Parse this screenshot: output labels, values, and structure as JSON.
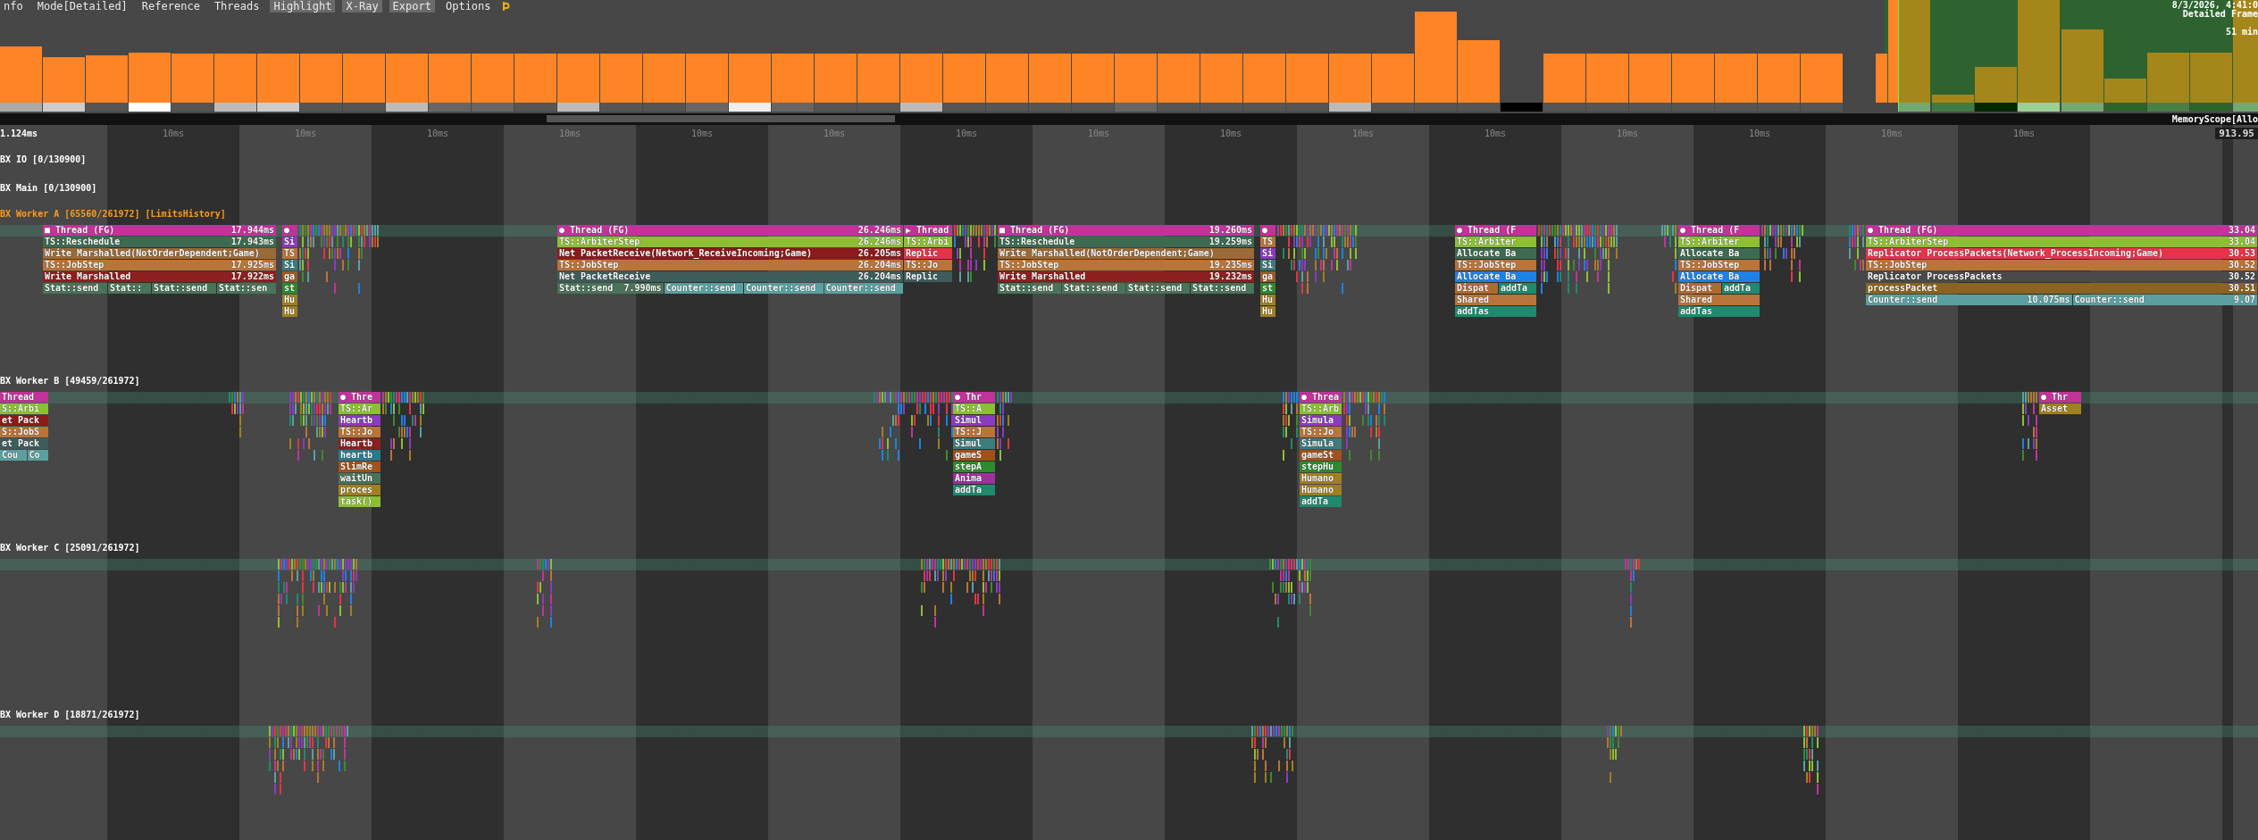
{
  "menu": [
    {
      "label": "nfo",
      "on": false
    },
    {
      "label": "Mode[Detailed]",
      "on": false
    },
    {
      "label": "Reference",
      "on": false
    },
    {
      "label": "Threads",
      "on": false
    },
    {
      "label": "Highlight",
      "on": true
    },
    {
      "label": "X-Ray",
      "on": true
    },
    {
      "label": "Export",
      "on": true
    },
    {
      "label": "Options",
      "on": false
    }
  ],
  "capture_info": {
    "date": "8/3/2026, 4:41:0",
    "mode": "Detailed Frame",
    "duration": "51 min"
  },
  "scrollbar": {
    "label": "MemoryScope[Allo"
  },
  "ruler": {
    "start": "1.124ms",
    "ticks": [
      "10ms",
      "10ms",
      "10ms",
      "10ms",
      "10ms",
      "10ms",
      "10ms",
      "10ms",
      "10ms",
      "10ms",
      "10ms",
      "10ms",
      "10ms",
      "10ms",
      "10ms"
    ],
    "end": "913.95"
  },
  "threads": [
    {
      "name": "BX IO [0/130900]",
      "selected": false
    },
    {
      "name": "BX Main [0/130900]",
      "selected": false
    },
    {
      "name": "BX Worker A [65560/261972] [LimitsHistory]",
      "selected": true,
      "stacks": [
        {
          "rows": [
            [
              {
                "label": "■ Thread (FG)",
                "time": "17.944ms",
                "color": "#c2339a"
              }
            ],
            [
              {
                "label": "TS::Reschedule",
                "time": "17.943ms",
                "color": "#3d6b52"
              }
            ],
            [
              {
                "label": "Write Marshalled(NotOrderDependent;Game)",
                "color": "#9a6a38"
              }
            ],
            [
              {
                "label": "TS::JobStep",
                "time": "17.925ms",
                "color": "#b8743a"
              }
            ],
            [
              {
                "label": "Write Marshalled",
                "time": "17.922ms",
                "color": "#8c2020"
              }
            ],
            [
              {
                "label": "Stat::send",
                "color": "#4b7358"
              },
              {
                "label": "Stat::",
                "color": "#4b7358"
              },
              {
                "label": "Stat::send",
                "color": "#4b7358"
              },
              {
                "label": "Stat::sen",
                "color": "#4b7358"
              }
            ]
          ]
        },
        {
          "rows": [
            [
              {
                "label": "●",
                "color": "#c2339a"
              }
            ],
            [
              {
                "label": "Si",
                "color": "#8b3bbf"
              }
            ],
            [
              {
                "label": "TS",
                "color": "#b8743a"
              }
            ],
            [
              {
                "label": "Si",
                "color": "#3e7c7c"
              }
            ],
            [
              {
                "label": "ga",
                "color": "#9c5a2a"
              }
            ],
            [
              {
                "label": "st",
                "color": "#2e8a2e"
              }
            ],
            [
              {
                "label": "Hu",
                "color": "#a08020"
              }
            ],
            [
              {
                "label": "Hu",
                "color": "#a08020"
              }
            ]
          ]
        },
        {
          "rows": [
            [
              {
                "label": "● Thread (FG)",
                "time": "26.246ms",
                "color": "#c2339a"
              }
            ],
            [
              {
                "label": "TS::ArbiterStep",
                "time": "26.246ms",
                "color": "#8dbf34"
              }
            ],
            [
              {
                "label": "Net PacketReceive(Network_ReceiveIncoming;Game)",
                "time": "26.205ms",
                "color": "#8c1b1b"
              }
            ],
            [
              {
                "label": "TS::JobStep",
                "time": "26.204ms",
                "color": "#b8743a"
              }
            ],
            [
              {
                "label": "Net PacketReceive",
                "time": "26.204ms",
                "color": "#3e5c5a"
              }
            ],
            [
              {
                "label": "Stat::send",
                "time": "7.990ms",
                "color": "#4b7358"
              },
              {
                "label": "Counter::send",
                "color": "#5aa0a0"
              },
              {
                "label": "Counter::send",
                "color": "#5aa0a0"
              },
              {
                "label": "Counter::send",
                "color": "#5aa0a0"
              }
            ]
          ]
        },
        {
          "rows": [
            [
              {
                "label": "▶ Thread",
                "color": "#c2339a"
              }
            ],
            [
              {
                "label": "TS::Arbi",
                "color": "#8dbf34"
              }
            ],
            [
              {
                "label": "Replic",
                "color": "#e33448"
              }
            ],
            [
              {
                "label": "TS::Jo",
                "color": "#b8743a"
              }
            ],
            [
              {
                "label": "Replic",
                "color": "#3e5c5a"
              }
            ]
          ]
        },
        {
          "rows": [
            [
              {
                "label": "■ Thread (FG)",
                "time": "19.260ms",
                "color": "#c2339a"
              }
            ],
            [
              {
                "label": "TS::Reschedule",
                "time": "19.259ms",
                "color": "#3d6b52"
              }
            ],
            [
              {
                "label": "Write Marshalled(NotOrderDependent;Game)",
                "color": "#9a6a38"
              }
            ],
            [
              {
                "label": "TS::JobStep",
                "time": "19.235ms",
                "color": "#b8743a"
              }
            ],
            [
              {
                "label": "Write Marshalled",
                "time": "19.232ms",
                "color": "#8c2020"
              }
            ],
            [
              {
                "label": "Stat::send",
                "color": "#4b7358"
              },
              {
                "label": "Stat::send",
                "color": "#4b7358"
              },
              {
                "label": "Stat::send",
                "color": "#4b7358"
              },
              {
                "label": "Stat::send",
                "color": "#4b7358"
              }
            ]
          ]
        },
        {
          "rows": [
            [
              {
                "label": "●",
                "color": "#c2339a"
              }
            ],
            [
              {
                "label": "TS",
                "color": "#b8743a"
              }
            ],
            [
              {
                "label": "Si",
                "color": "#8b3bbf"
              }
            ],
            [
              {
                "label": "Si",
                "color": "#3e7c7c"
              }
            ],
            [
              {
                "label": "ga",
                "color": "#9c5a2a"
              }
            ],
            [
              {
                "label": "st",
                "color": "#2e8a2e"
              }
            ],
            [
              {
                "label": "Hu",
                "color": "#a08020"
              }
            ],
            [
              {
                "label": "Hu",
                "color": "#a08020"
              }
            ]
          ]
        },
        {
          "rows": [
            [
              {
                "label": "● Thread (F",
                "color": "#c2339a"
              }
            ],
            [
              {
                "label": "TS::Arbiter",
                "color": "#8dbf34"
              }
            ],
            [
              {
                "label": "Allocate Ba",
                "color": "#3d6b52"
              }
            ],
            [
              {
                "label": "TS::JobStep",
                "color": "#b8743a"
              }
            ],
            [
              {
                "label": "Allocate Ba",
                "color": "#1f80e6"
              }
            ],
            [
              {
                "label": "Dispat",
                "color": "#b06a30"
              },
              {
                "label": "addTa",
                "color": "#1f8a6e"
              }
            ],
            [
              {
                "label": "Shared",
                "color": "#b8743a"
              }
            ],
            [
              {
                "label": "addTas",
                "color": "#1f8a6e"
              }
            ]
          ]
        },
        {
          "rows": [
            [
              {
                "label": "● Thread (F",
                "color": "#c2339a"
              }
            ],
            [
              {
                "label": "TS::Arbiter",
                "color": "#8dbf34"
              }
            ],
            [
              {
                "label": "Allocate Ba",
                "color": "#3d6b52"
              }
            ],
            [
              {
                "label": "TS::JobStep",
                "color": "#b8743a"
              }
            ],
            [
              {
                "label": "Allocate Ba",
                "color": "#1f80e6"
              }
            ],
            [
              {
                "label": "Dispat",
                "color": "#b06a30"
              },
              {
                "label": "addTa",
                "color": "#1f8a6e"
              }
            ],
            [
              {
                "label": "Shared",
                "color": "#b8743a"
              }
            ],
            [
              {
                "label": "addTas",
                "color": "#1f8a6e"
              }
            ]
          ]
        },
        {
          "rows": [
            [
              {
                "label": "● Thread (FG)",
                "time": "33.04",
                "color": "#c2339a"
              }
            ],
            [
              {
                "label": "TS::ArbiterStep",
                "time": "33.04",
                "color": "#8dbf34"
              }
            ],
            [
              {
                "label": "Replicator ProcessPackets(Network_ProcessIncoming;Game)",
                "time": "30.53",
                "color": "#e8334a"
              }
            ],
            [
              {
                "label": "TS::JobStep",
                "time": "30.52",
                "color": "#b8743a"
              }
            ],
            [
              {
                "label": "Replicator ProcessPackets",
                "time": "30.52",
                "color": "#4a4a4a"
              }
            ],
            [
              {
                "label": "processPacket",
                "time": "30.51",
                "color": "#8a6420"
              }
            ],
            [
              {
                "label": "Counter::send",
                "time": "10.075ms",
                "color": "#5aa0a0"
              },
              {
                "label": "Counter::send",
                "time": "9.07",
                "color": "#5aa0a0"
              }
            ]
          ]
        }
      ]
    },
    {
      "name": "BX Worker B [49459/261972]",
      "selected": false,
      "stacks": [
        {
          "rows": [
            [
              {
                "label": "Thread",
                "color": "#c2339a"
              }
            ],
            [
              {
                "label": "S::Arbi",
                "color": "#8dbf34"
              }
            ],
            [
              {
                "label": "et Pack",
                "color": "#8c1b1b"
              }
            ],
            [
              {
                "label": "S::JobS",
                "color": "#b8743a"
              }
            ],
            [
              {
                "label": "et Pack",
                "color": "#3e5c5a"
              }
            ],
            [
              {
                "label": "Cou",
                "color": "#5aa0a0"
              },
              {
                "label": "Co",
                "color": "#5aa0a0"
              }
            ]
          ]
        },
        {
          "rows": [
            [
              {
                "label": "● Thre",
                "color": "#c2339a"
              }
            ],
            [
              {
                "label": "TS::Ar",
                "color": "#8dbf34"
              }
            ],
            [
              {
                "label": "Heartb",
                "color": "#8b3bbf"
              }
            ],
            [
              {
                "label": "TS::Jo",
                "color": "#b8743a"
              }
            ],
            [
              {
                "label": "Heartb",
                "color": "#8c2020"
              }
            ],
            [
              {
                "label": "heartb",
                "color": "#2a7a8a"
              }
            ],
            [
              {
                "label": "SlimRe",
                "color": "#a0521a"
              }
            ],
            [
              {
                "label": "waitUn",
                "color": "#4b7358"
              }
            ],
            [
              {
                "label": "proces",
                "color": "#a08020"
              }
            ],
            [
              {
                "label": "task()",
                "color": "#8dbf34"
              }
            ]
          ]
        },
        {
          "rows": [
            [
              {
                "label": "● Thr",
                "color": "#c2339a"
              }
            ],
            [
              {
                "label": "TS::A",
                "color": "#8dbf34"
              }
            ],
            [
              {
                "label": "Simul",
                "color": "#8b3bbf"
              }
            ],
            [
              {
                "label": "TS::J",
                "color": "#b8743a"
              }
            ],
            [
              {
                "label": "Simul",
                "color": "#3e7c7c"
              }
            ],
            [
              {
                "label": "gameS",
                "color": "#a0521a"
              }
            ],
            [
              {
                "label": "stepA",
                "color": "#2e8a2e"
              }
            ],
            [
              {
                "label": "Anima",
                "color": "#a0309a"
              }
            ],
            [
              {
                "label": "addTa",
                "color": "#1f8a6e"
              }
            ]
          ]
        },
        {
          "rows": [
            [
              {
                "label": "● Threa",
                "color": "#c2339a"
              }
            ],
            [
              {
                "label": "TS::Arb",
                "color": "#8dbf34"
              }
            ],
            [
              {
                "label": "Simula",
                "color": "#8b3bbf"
              }
            ],
            [
              {
                "label": "TS::Jo",
                "color": "#b8743a"
              }
            ],
            [
              {
                "label": "Simula",
                "color": "#3e7c7c"
              }
            ],
            [
              {
                "label": "gameSt",
                "color": "#a0521a"
              }
            ],
            [
              {
                "label": "stepHu",
                "color": "#2e8a2e"
              }
            ],
            [
              {
                "label": "Humano",
                "color": "#a08020"
              }
            ],
            [
              {
                "label": "Humano",
                "color": "#a08020"
              }
            ],
            [
              {
                "label": "addTa",
                "color": "#1f8a6e"
              }
            ]
          ]
        },
        {
          "rows": [
            [
              {
                "label": "● Thr",
                "color": "#c2339a"
              }
            ],
            [
              {
                "label": "Asset",
                "color": "#a08020"
              }
            ]
          ]
        }
      ]
    },
    {
      "name": "BX Worker C [25091/261972]",
      "selected": false
    },
    {
      "name": "BX Worker D [18871/261972]",
      "selected": false
    }
  ]
}
